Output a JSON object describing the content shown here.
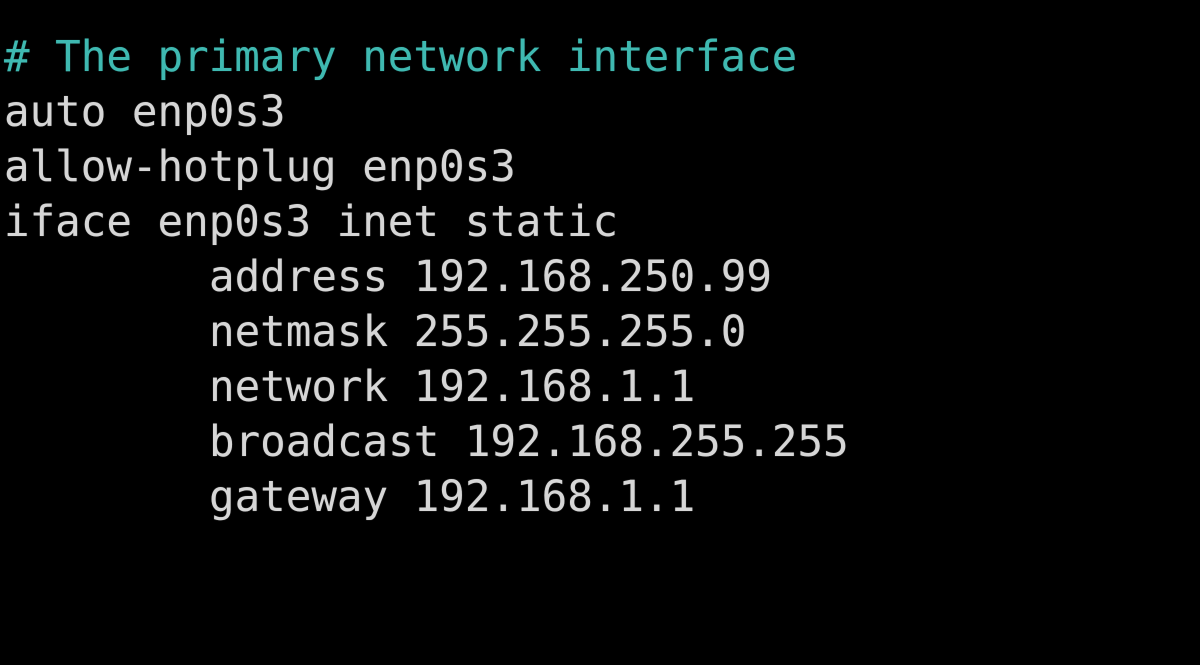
{
  "terminal": {
    "background": "#000000",
    "text_color": "#d6d6d6",
    "comment_color": "#3fb9b1",
    "lines": [
      {
        "text": "# The primary network interface",
        "kind": "comment"
      },
      {
        "text": "auto enp0s3",
        "kind": "directive"
      },
      {
        "text": "allow-hotplug enp0s3",
        "kind": "directive"
      },
      {
        "text": "iface enp0s3 inet static",
        "kind": "directive"
      },
      {
        "text": "address 192.168.250.99",
        "kind": "option"
      },
      {
        "text": "netmask 255.255.255.0",
        "kind": "option"
      },
      {
        "text": "network 192.168.1.1",
        "kind": "option"
      },
      {
        "text": "broadcast 192.168.255.255",
        "kind": "option"
      },
      {
        "text": "gateway 192.168.1.1",
        "kind": "option"
      }
    ]
  }
}
